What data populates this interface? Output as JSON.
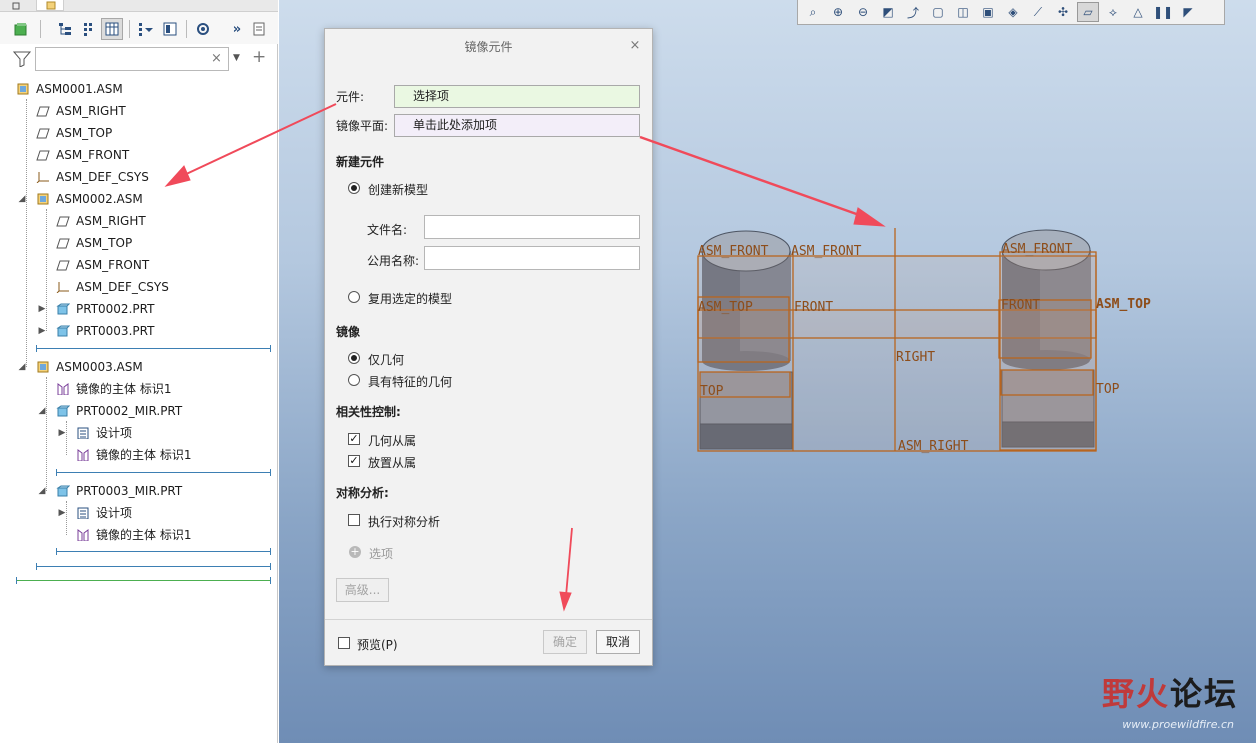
{
  "tree": {
    "filter_placeholder": "",
    "items": [
      {
        "label": "ASM0001.ASM"
      },
      {
        "label": "ASM_RIGHT"
      },
      {
        "label": "ASM_TOP"
      },
      {
        "label": "ASM_FRONT"
      },
      {
        "label": "ASM_DEF_CSYS"
      },
      {
        "label": "ASM0002.ASM"
      },
      {
        "label": "ASM_RIGHT"
      },
      {
        "label": "ASM_TOP"
      },
      {
        "label": "ASM_FRONT"
      },
      {
        "label": "ASM_DEF_CSYS"
      },
      {
        "label": "PRT0002.PRT"
      },
      {
        "label": "PRT0003.PRT"
      },
      {
        "label": "ASM0003.ASM"
      },
      {
        "label": "镜像的主体 标识1"
      },
      {
        "label": "PRT0002_MIR.PRT"
      },
      {
        "label": "设计项"
      },
      {
        "label": "镜像的主体 标识1"
      },
      {
        "label": "PRT0003_MIR.PRT"
      },
      {
        "label": "设计项"
      },
      {
        "label": "镜像的主体 标识1"
      }
    ]
  },
  "dialog": {
    "title": "镜像元件",
    "close": "×",
    "component_label": "元件:",
    "component_value": "选择项",
    "mirror_plane_label": "镜像平面:",
    "mirror_plane_value": "单击此处添加项",
    "new_component_section": "新建元件",
    "create_new_model": "创建新模型",
    "filename_label": "文件名:",
    "filename_value": "",
    "common_name_label": "公用名称:",
    "common_name_value": "",
    "reuse_model": "复用选定的模型",
    "mirror_section": "镜像",
    "geometry_only": "仅几何",
    "geometry_with_features": "具有特征的几何",
    "dependency_section": "相关性控制:",
    "geometry_dependent": "几何从属",
    "placement_dependent": "放置从属",
    "symmetry_section": "对称分析:",
    "run_symmetry": "执行对称分析",
    "options": "选项",
    "advanced": "高级...",
    "preview": "预览(P)",
    "ok": "确定",
    "cancel": "取消"
  },
  "scene_labels": {
    "l1": "ASM_FRONT",
    "l2": "ASM_FRONT",
    "l3": "ASM_FRONT",
    "l4": "ASM_TOP",
    "l5": "FRONT",
    "l6": "FRONT",
    "l7": "ASM_TOP",
    "l8": "RIGHT",
    "l9": "TOP",
    "l10": "TOP",
    "l11": "ASM_RIGHT"
  },
  "watermark": {
    "logo_a": "野火",
    "logo_b": "论坛",
    "url": "www.proewildfire.cn"
  },
  "colors": {
    "accent": "#3d7fb3",
    "datum_orange": "#b8651e",
    "annotation_red": "#f04a5a",
    "collector_green": "#eaf8e2",
    "collector_lilac": "#f3eef9"
  }
}
